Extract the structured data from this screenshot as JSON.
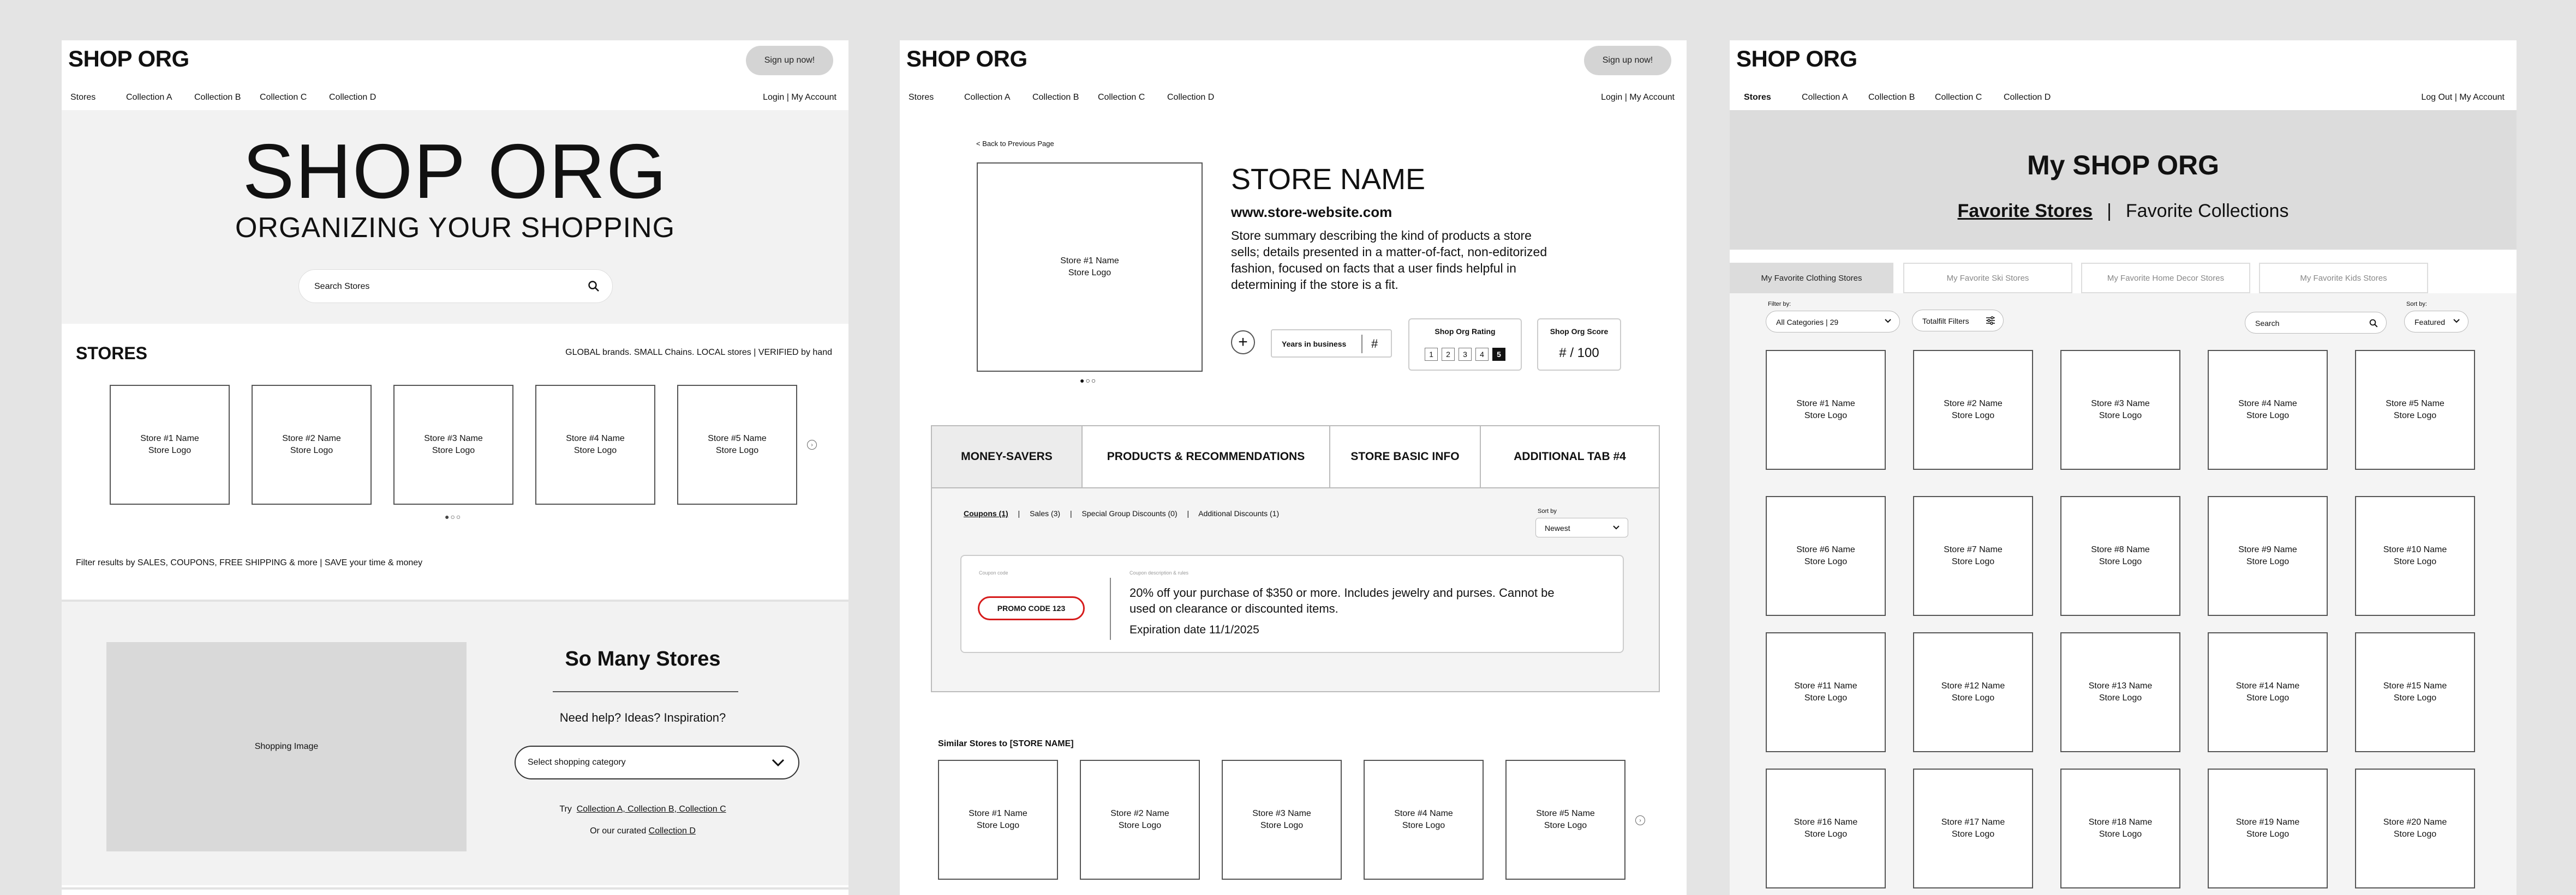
{
  "header": {
    "logo": "SHOP ORG",
    "signup_label": "Sign up now!",
    "nav": [
      "Stores",
      "Collection A",
      "Collection B",
      "Collection C",
      "Collection D"
    ],
    "account": "Login | My Account",
    "account_logged_in": "Log Out | My Account"
  },
  "home": {
    "hero_title": "SHOP ORG",
    "hero_subtitle": "ORGANIZING YOUR SHOPPING",
    "search_placeholder": "Search Stores",
    "stores_title": "STORES",
    "stores_tagline": "GLOBAL brands. SMALL Chains. LOCAL stores | VERIFIED by hand",
    "stores": [
      "Store #1 Name\nStore Logo",
      "Store #2 Name\nStore Logo",
      "Store #3 Name\nStore Logo",
      "Store #4 Name\nStore Logo",
      "Store #5 Name\nStore Logo"
    ],
    "carousel_dots": "●○○",
    "filter_note": "Filter results by SALES, COUPONS, FREE SHIPPING & more | SAVE your time & money",
    "shopping_image": "Shopping Image",
    "many_title": "So Many Stores",
    "many_help": "Need help? Ideas? Inspiration?",
    "select_label": "Select shopping category",
    "try_prefix": "Try",
    "try_links": "Collection A, Collection B, Collection C",
    "curated_prefix": "Or our curated",
    "curated_link": "Collection D"
  },
  "store_page": {
    "back_link": "< Back to Previous Page",
    "logo_box": "Store #1 Name\nStore Logo",
    "image_dots": "●○○",
    "name": "STORE NAME",
    "url": "www.store-website.com",
    "summary": "Store summary describing the kind of products a store sells; details presented in a matter-of-fact, non-editorized fashion, focused on facts that a user finds helpful in determining if the store is a fit.",
    "plus": "+",
    "years_label": "Years in business",
    "years_value": "#",
    "rating_label": "Shop Org Rating",
    "rating_options": [
      "1",
      "2",
      "3",
      "4",
      "5"
    ],
    "rating_selected": 5,
    "score_label": "Shop Org Score",
    "score_value": "# / 100",
    "tabs": [
      "MONEY-SAVERS",
      "PRODUCTS & RECOMMENDATIONS",
      "STORE BASIC INFO",
      "ADDITIONAL TAB #4"
    ],
    "subtabs": [
      "Coupons (1)",
      "|",
      "Sales (3)",
      "|",
      "Special Group Discounts (0)",
      "|",
      "Additional Discounts (1)"
    ],
    "sort_label": "Sort by",
    "sort_value": "Newest",
    "coupon_code_label": "Coupon code",
    "coupon_code": "PROMO CODE 123",
    "coupon_desc_label": "Coupon description & rules",
    "coupon_desc": "20% off your purchase of $350 or more. Includes jewelry and purses. Cannot be used on clearance or discounted items.",
    "coupon_exp": "Expiration date 11/1/2025",
    "similar_title": "Similar Stores to [STORE NAME]",
    "similar": [
      "Store #1 Name\nStore Logo",
      "Store #2 Name\nStore Logo",
      "Store #3 Name\nStore Logo",
      "Store #4 Name\nStore Logo",
      "Store #5 Name\nStore Logo"
    ]
  },
  "my_page": {
    "title": "My SHOP ORG",
    "fav_stores": "Favorite Stores",
    "separator": "|",
    "fav_collections": "Favorite Collections",
    "tabs": [
      "My Favorite Clothing Stores",
      "My Favorite Ski Stores",
      "My Favorite Home Decor Stores",
      "My Favorite Kids Stores"
    ],
    "filter_by": "Filter by:",
    "category_select": "All Categories | 29",
    "total_filters": "Totalfilt Filters",
    "search_placeholder": "Search",
    "sort_by": "Sort by:",
    "sort_value": "Featured",
    "grid": [
      "Store #1 Name\nStore Logo",
      "Store #2 Name\nStore Logo",
      "Store #3 Name\nStore Logo",
      "Store #4 Name\nStore Logo",
      "Store #5 Name\nStore Logo",
      "Store #6 Name\nStore Logo",
      "Store #7 Name\nStore Logo",
      "Store #8 Name\nStore Logo",
      "Store #9 Name\nStore Logo",
      "Store #10 Name\nStore Logo",
      "Store #11 Name\nStore Logo",
      "Store #12 Name\nStore Logo",
      "Store #13 Name\nStore Logo",
      "Store #14 Name\nStore Logo",
      "Store #15 Name\nStore Logo",
      "Store #16 Name\nStore Logo",
      "Store #17 Name\nStore Logo",
      "Store #18 Name\nStore Logo",
      "Store #19 Name\nStore Logo",
      "Store #20 Name\nStore Logo"
    ]
  }
}
